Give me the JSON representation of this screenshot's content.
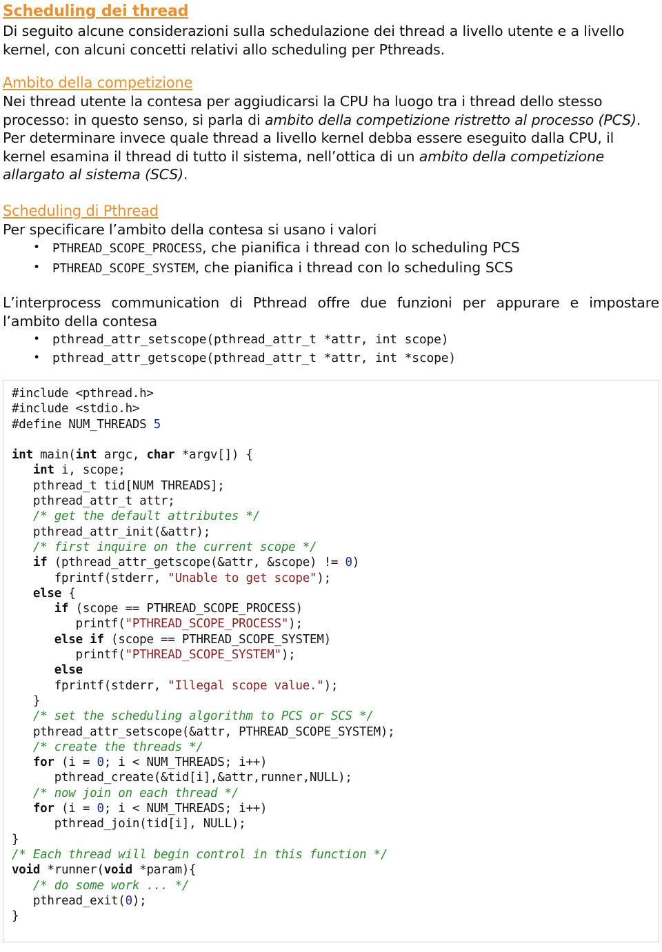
{
  "document": {
    "title": "Scheduling dei thread",
    "intro": "Di seguito alcune considerazioni sulla schedulazione dei thread a livello utente e a livello kernel, con alcuni concetti relativi allo scheduling per Pthreads.",
    "accent_color": "#E8912D",
    "text_color": "#111111"
  },
  "section_scope": {
    "heading": "Ambito della competizione",
    "para_part1": "Nei thread utente la contesa per aggiudicarsi la CPU ha luogo tra i thread dello stesso processo: in questo senso, si parla di ",
    "para_italic1": "ambito della competizione ristretto al processo (PCS)",
    "para_part2": ". Per determinare invece quale thread a livello kernel debba essere eseguito dalla CPU, il kernel esamina il thread di tutto il sistema, nell’ottica di un ",
    "para_italic2": "ambito della competizione allargato al sistema (SCS)",
    "para_part3": "."
  },
  "section_pthread": {
    "heading": "Scheduling di Pthread",
    "lead": "Per specificare l’ambito della contesa si usano i valori",
    "bullets": [
      {
        "code": "PTHREAD_SCOPE_PROCESS",
        "rest": ", che pianifica i thread con lo scheduling PCS"
      },
      {
        "code": "PTHREAD_SCOPE_SYSTEM",
        "rest": ", che pianifica i thread con lo scheduling SCS"
      }
    ]
  },
  "section_ipc": {
    "para": "L’interprocess communication di Pthread offre due funzioni per appurare e impostare l’ambito della contesa",
    "bullets": [
      "pthread_attr_setscope(pthread_attr_t *attr, int scope)",
      "pthread_attr_getscope(pthread_attr_t *attr, int *scope)"
    ]
  },
  "code_block": {
    "language": "c",
    "comment_color": "#2F8A32",
    "string_color": "#8C2121",
    "number_color": "#1A2E8C",
    "lines": [
      "#include <pthread.h>",
      "#include <stdio.h>",
      "#define NUM_THREADS 5",
      "",
      "int main(int argc, char *argv[]) {",
      "   int i, scope;",
      "   pthread_t tid[NUM THREADS];",
      "   pthread_attr_t attr;",
      "   /* get the default attributes */",
      "   pthread_attr_init(&attr);",
      "   /* first inquire on the current scope */",
      "   if (pthread_attr_getscope(&attr, &scope) != 0)",
      "      fprintf(stderr, \"Unable to get scope\");",
      "   else {",
      "      if (scope == PTHREAD_SCOPE_PROCESS)",
      "         printf(\"PTHREAD_SCOPE_PROCESS\");",
      "      else if (scope == PTHREAD_SCOPE_SYSTEM)",
      "         printf(\"PTHREAD_SCOPE_SYSTEM\");",
      "      else",
      "      fprintf(stderr, \"Illegal scope value.\");",
      "   }",
      "   /* set the scheduling algorithm to PCS or SCS */",
      "   pthread_attr_setscope(&attr, PTHREAD_SCOPE_SYSTEM);",
      "   /* create the threads */",
      "   for (i = 0; i < NUM_THREADS; i++)",
      "      pthread_create(&tid[i],&attr,runner,NULL);",
      "   /* now join on each thread */",
      "   for (i = 0; i < NUM_THREADS; i++)",
      "      pthread_join(tid[i], NULL);",
      "}",
      "/* Each thread will begin control in this function */",
      "void *runner(void *param){",
      "   /* do some work ... */",
      "   pthread_exit(0);",
      "}"
    ]
  }
}
